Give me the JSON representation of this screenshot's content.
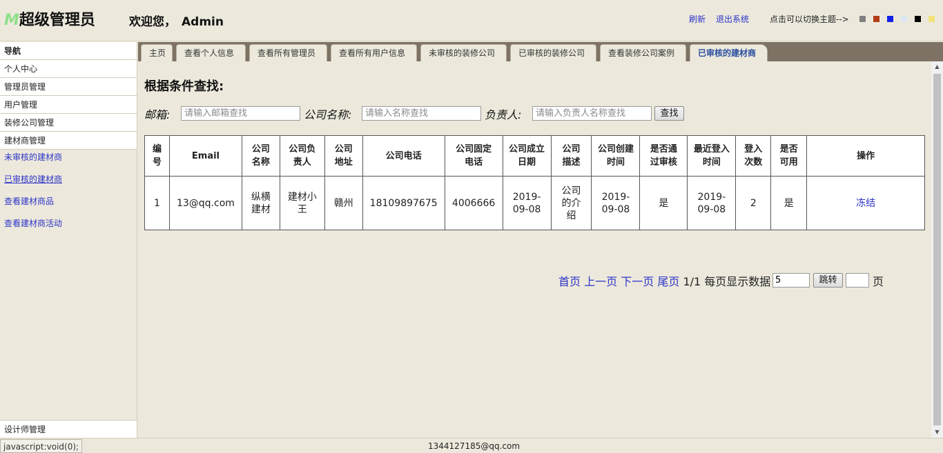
{
  "header": {
    "logo_mark": "M",
    "title": "超级管理员",
    "welcome": "欢迎您，",
    "username": "Admin",
    "refresh": "刷新",
    "logout": "退出系统",
    "theme_label": "点击可以切换主题-->",
    "theme_swatches": [
      "#808080",
      "#b23c17",
      "#1420e8",
      "#dbe6f2",
      "#000000",
      "#f5e27a"
    ]
  },
  "sidebar": {
    "title": "导航",
    "items": [
      "个人中心",
      "管理员管理",
      "用户管理",
      "装修公司管理",
      "建材商管理"
    ],
    "subitems": [
      "未审核的建材商",
      "已审核的建材商",
      "查看建材商品",
      "查看建材商活动"
    ],
    "bottom_item": "设计师管理"
  },
  "tabs": [
    "主页",
    "查看个人信息",
    "查看所有管理员",
    "查看所有用户信息",
    "未审核的装修公司",
    "已审核的装修公司",
    "查看装修公司案例",
    "已审核的建材商"
  ],
  "search": {
    "title": "根据条件查找:",
    "email_label": "邮箱:",
    "email_placeholder": "请输入邮箱查找",
    "company_label": "公司名称:",
    "company_placeholder": "请输入名称查找",
    "owner_label": "负责人:",
    "owner_placeholder": "请输入负责人名称查找",
    "submit": "查找"
  },
  "table": {
    "headers": [
      "编号",
      "Email",
      "公司名称",
      "公司负责人",
      "公司地址",
      "公司电话",
      "公司固定电话",
      "公司成立日期",
      "公司描述",
      "公司创建时间",
      "是否通过审核",
      "最近登入时间",
      "登入次数",
      "是否可用",
      "操作"
    ],
    "rows": [
      [
        "1",
        "13@qq.com",
        "纵横建材",
        "建材小王",
        "赣州",
        "18109897675",
        "4006666",
        "2019-09-08",
        "公司的介绍",
        "2019-09-08",
        "是",
        "2019-09-08",
        "2",
        "是",
        "冻结"
      ]
    ]
  },
  "pager": {
    "first": "首页",
    "prev": "上一页",
    "next": "下一页",
    "last": "尾页",
    "page_info": "1/1",
    "per_page_label": "每页显示数据",
    "per_page_value": "5",
    "jump": "跳转",
    "page_suffix": "页"
  },
  "status": {
    "url": "javascript:void(0);",
    "center": "1344127185@qq.com"
  }
}
